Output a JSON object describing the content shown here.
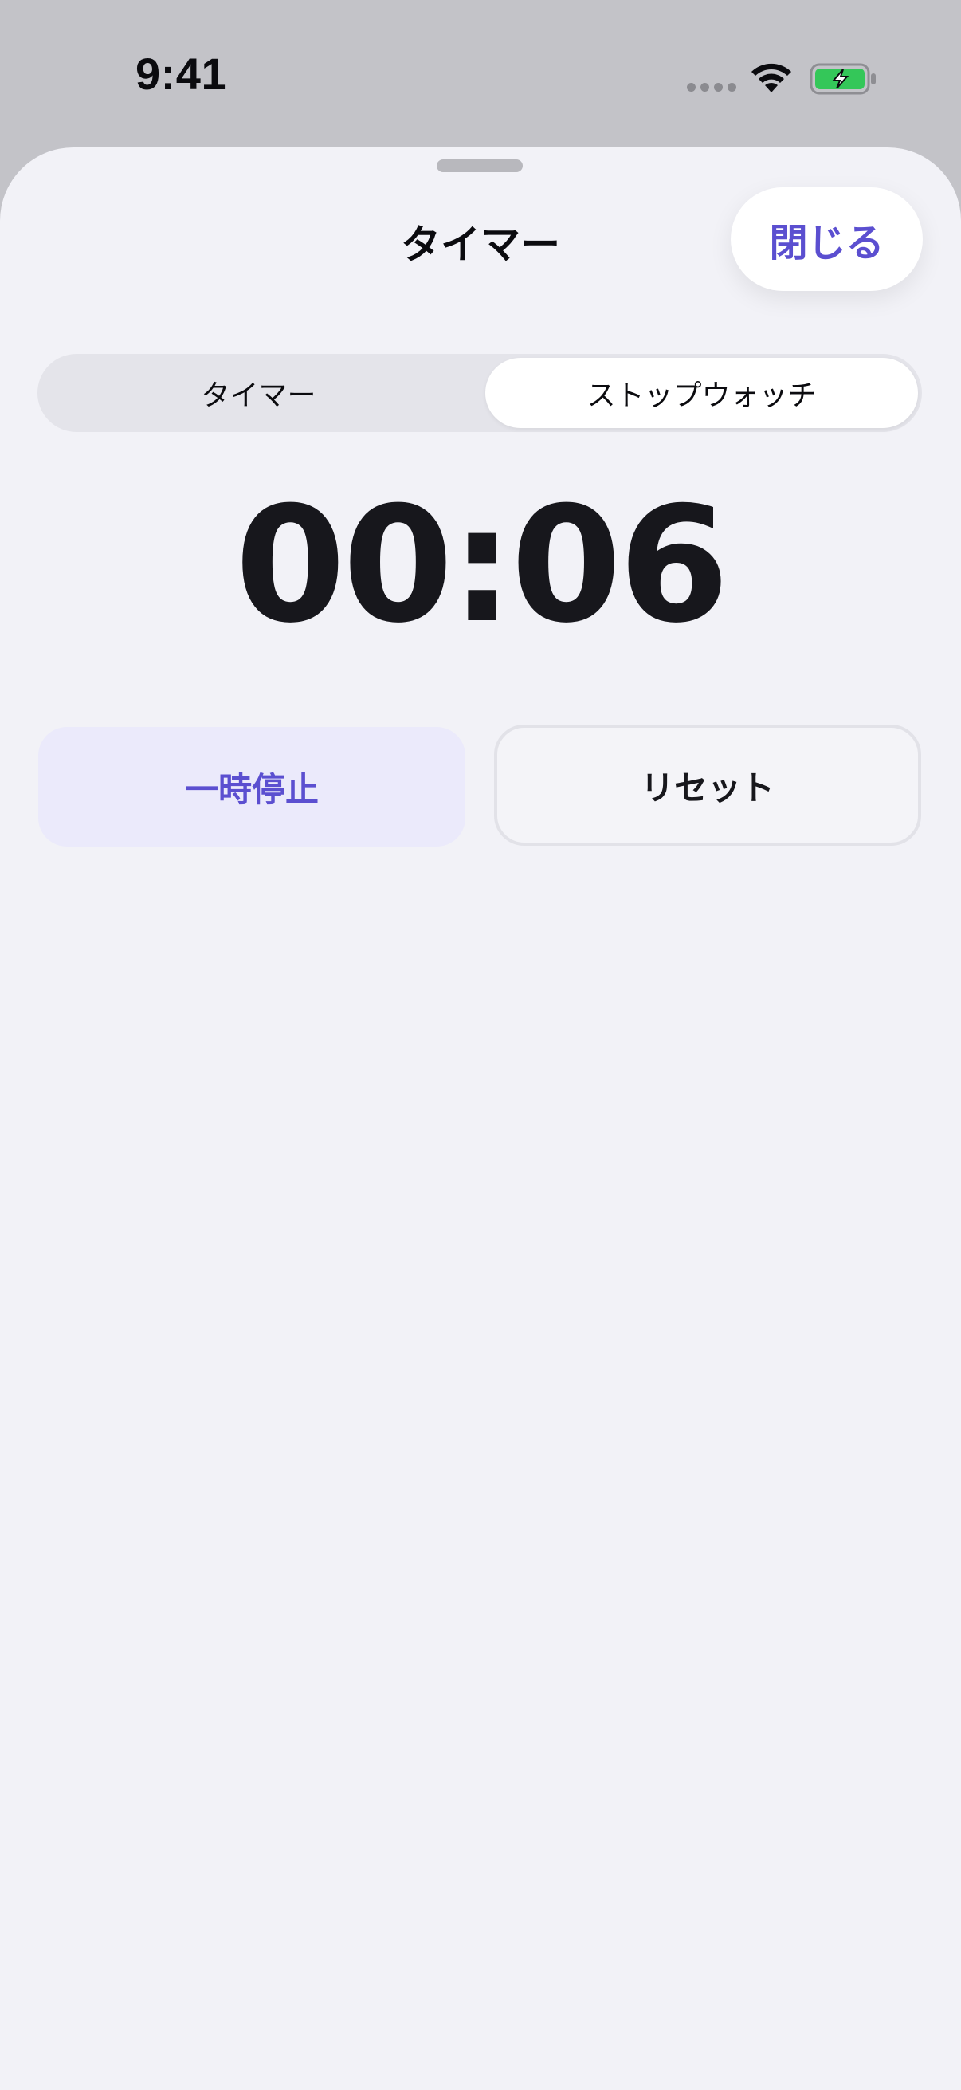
{
  "status_bar": {
    "time": "9:41",
    "icons": [
      "cellular-signal-icon",
      "wifi-icon",
      "battery-charging-icon"
    ],
    "battery_color": "#34c759"
  },
  "sheet": {
    "title": "タイマー",
    "close_label": "閉じる"
  },
  "segmented_control": {
    "segments": [
      "タイマー",
      "ストップウォッチ"
    ],
    "selected": "ストップウォッチ"
  },
  "stopwatch": {
    "elapsed": "00:06"
  },
  "actions": {
    "pause_label": "一時停止",
    "reset_label": "リセット"
  },
  "colors": {
    "accent": "#5b4fd0",
    "sheet_background": "#f2f2f7",
    "pause_background": "#ebeafb"
  }
}
